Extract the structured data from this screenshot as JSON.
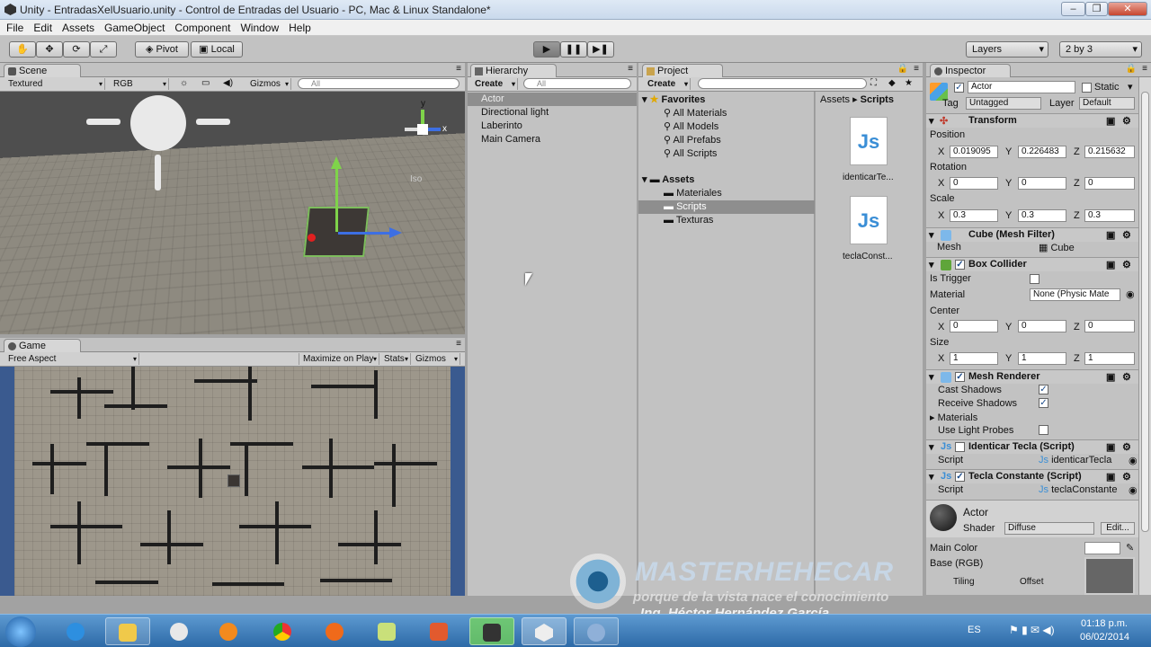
{
  "window": {
    "title": "Unity - EntradasXelUsuario.unity - Control de Entradas del Usuario - PC, Mac & Linux Standalone*",
    "min": "–",
    "max": "❐",
    "close": "✕"
  },
  "menu": [
    "File",
    "Edit",
    "Assets",
    "GameObject",
    "Component",
    "Window",
    "Help"
  ],
  "toolbar": {
    "pivot": "Pivot",
    "local": "Local",
    "layers": "Layers",
    "layout": "2 by 3"
  },
  "scene": {
    "tab": "Scene",
    "render_mode": "Textured",
    "color_mode": "RGB",
    "gizmos": "Gizmos",
    "search": "All",
    "axis_y": "y",
    "axis_x": "x",
    "iso": "Iso"
  },
  "game": {
    "tab": "Game",
    "aspect": "Free Aspect",
    "maximize": "Maximize on Play",
    "stats": "Stats",
    "gizmos": "Gizmos"
  },
  "hierarchy": {
    "tab": "Hierarchy",
    "create": "Create",
    "search": "All",
    "items": [
      "Actor",
      "Directional light",
      "Laberinto",
      "Main Camera"
    ]
  },
  "project": {
    "tab": "Project",
    "create": "Create",
    "favorites_label": "Favorites",
    "favorites": [
      "All Materials",
      "All Models",
      "All Prefabs",
      "All Scripts"
    ],
    "assets_label": "Assets",
    "folders": [
      "Materiales",
      "Scripts",
      "Texturas"
    ],
    "breadcrumb": [
      "Assets",
      "Scripts"
    ],
    "files": [
      "identicarTe...",
      "teclaConst..."
    ]
  },
  "inspector": {
    "tab": "Inspector",
    "name": "Actor",
    "static": "Static",
    "tag_label": "Tag",
    "tag": "Untagged",
    "layer_label": "Layer",
    "layer": "Default",
    "transform": {
      "title": "Transform",
      "position_label": "Position",
      "position": [
        "0.019095",
        "0.226483",
        "0.215632"
      ],
      "rotation_label": "Rotation",
      "rotation": [
        "0",
        "0",
        "0"
      ],
      "scale_label": "Scale",
      "scale": [
        "0.3",
        "0.3",
        "0.3"
      ]
    },
    "axes": [
      "X",
      "Y",
      "Z"
    ],
    "mesh_filter": {
      "title": "Cube (Mesh Filter)",
      "mesh_label": "Mesh",
      "mesh": "Cube"
    },
    "box_collider": {
      "title": "Box Collider",
      "trigger_label": "Is Trigger",
      "material_label": "Material",
      "material": "None (Physic Mate",
      "center_label": "Center",
      "center": [
        "0",
        "0",
        "0"
      ],
      "size_label": "Size",
      "size": [
        "1",
        "1",
        "1"
      ]
    },
    "mesh_renderer": {
      "title": "Mesh Renderer",
      "cast": "Cast Shadows",
      "receive": "Receive Shadows",
      "materials": "Materials",
      "light_probes": "Use Light Probes"
    },
    "script1": {
      "title": "Identicar Tecla (Script)",
      "label": "Script",
      "value": "identicarTecla"
    },
    "script2": {
      "title": "Tecla Constante (Script)",
      "label": "Script",
      "value": "teclaConstante"
    },
    "material": {
      "name": "Actor",
      "shader_label": "Shader",
      "shader": "Diffuse",
      "edit": "Edit...",
      "main_color": "Main Color",
      "base": "Base (RGB)",
      "tiling": "Tiling",
      "offset": "Offset"
    }
  },
  "watermark": {
    "brand": "MASTERHEHECAR",
    "slogan": "porque de la vista nace el conocimiento",
    "author": "Ing. Héctor Hernández García"
  },
  "taskbar": {
    "lang": "ES",
    "time": "01:18 p.m.",
    "date": "06/02/2014"
  },
  "colors": {
    "selection": "#3d7ec8",
    "unity_bg": "#c2c2c2",
    "taskbar": "#2d6aa7"
  }
}
